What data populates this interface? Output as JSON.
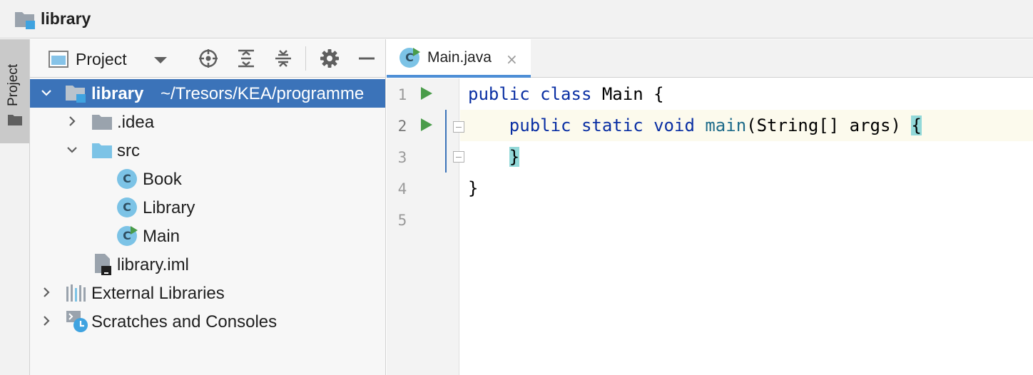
{
  "navbar": {
    "project_name": "library",
    "icon": "project-folder-icon"
  },
  "tool_stripe": {
    "project_tab_label": "Project"
  },
  "project_panel": {
    "view_label": "Project",
    "toolbar_icons": [
      "locate-icon",
      "expand-all-icon",
      "collapse-all-icon",
      "gear-icon",
      "minimize-icon"
    ],
    "tree": [
      {
        "label": "library",
        "path": "~/Tresors/KEA/programme",
        "icon": "project-folder-icon",
        "expanded": true,
        "selected": true,
        "depth": 0
      },
      {
        "label": ".idea",
        "icon": "folder-icon",
        "expanded": false,
        "depth": 1
      },
      {
        "label": "src",
        "icon": "source-folder-icon",
        "expanded": true,
        "depth": 1
      },
      {
        "label": "Book",
        "icon": "class-icon",
        "depth": 2
      },
      {
        "label": "Library",
        "icon": "class-icon",
        "depth": 2
      },
      {
        "label": "Main",
        "icon": "runnable-class-icon",
        "depth": 2
      },
      {
        "label": "library.iml",
        "icon": "module-file-icon",
        "depth": 1
      },
      {
        "label": "External Libraries",
        "icon": "libraries-icon",
        "expanded": false,
        "depth": 0
      },
      {
        "label": "Scratches and Consoles",
        "icon": "scratches-icon",
        "expanded": false,
        "depth": 0
      }
    ]
  },
  "editor": {
    "tab": {
      "label": "Main.java",
      "close_glyph": "×",
      "icon": "runnable-class-icon"
    },
    "line_numbers": [
      "1",
      "2",
      "3",
      "4",
      "5"
    ],
    "lines": [
      {
        "kw1": "public",
        "kw2": "class",
        "rest": " Main {"
      },
      {
        "kw1": "public",
        "kw2": "static",
        "kw3": "void",
        "fn": "main",
        "rest": "(String[] args) ",
        "brace": "{"
      },
      {
        "brace": "}"
      },
      {
        "rest": "}"
      },
      {
        "rest": ""
      }
    ]
  },
  "colors": {
    "selection": "#3b73b9",
    "keyword": "#0a2fa3",
    "run_gutter": "#4a9c4a",
    "class_icon": "#7cc3e6",
    "brace_highlight": "#93d9d9"
  }
}
